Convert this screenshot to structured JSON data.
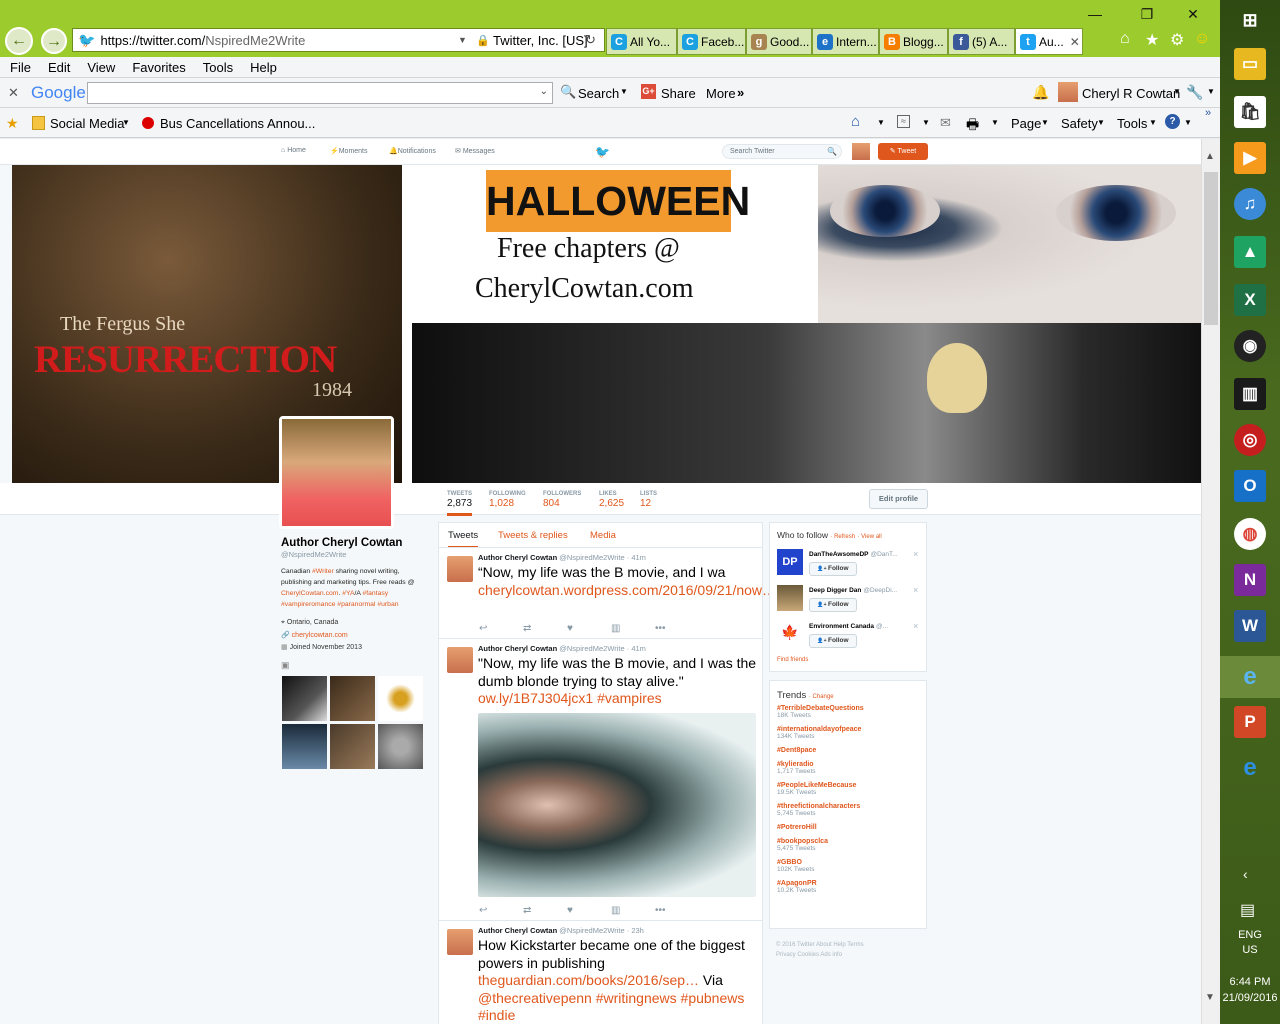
{
  "browser": {
    "url_prefix": "https://twitter.com/",
    "url_path": "NspiredMe2Write",
    "cert": "Twitter, Inc. [US]",
    "tabs": [
      {
        "label": "All Yo...",
        "icon": "C",
        "color": "#1ba0e0"
      },
      {
        "label": "Faceb...",
        "icon": "C",
        "color": "#1ba0e0"
      },
      {
        "label": "Good...",
        "icon": "g",
        "color": "#a88450"
      },
      {
        "label": "Intern...",
        "icon": "e",
        "color": "#1e73c8"
      },
      {
        "label": "Blogg...",
        "icon": "B",
        "color": "#f57d00"
      },
      {
        "label": "(5) A...",
        "icon": "f",
        "color": "#3b5998"
      },
      {
        "label": "Au...",
        "icon": "t",
        "color": "#1da1f2"
      }
    ],
    "menu": [
      "File",
      "Edit",
      "View",
      "Favorites",
      "Tools",
      "Help"
    ],
    "google_logo": "Google",
    "search_label": "Search",
    "share_label": "Share",
    "more_label": "More",
    "user_name": "Cheryl R Cowtan",
    "favorites": [
      "Social Media",
      "Bus Cancellations Annou..."
    ],
    "cmd": [
      "Page",
      "Safety",
      "Tools"
    ]
  },
  "twitter_nav": {
    "home": "Home",
    "moments": "Moments",
    "notifications": "Notifications",
    "messages": "Messages",
    "search_placeholder": "Search Twitter",
    "tweet_button": "Tweet"
  },
  "banner": {
    "book_line1": "The Fergus She",
    "book_line2": "RESURRECTION",
    "book_year": "1984",
    "halloween": "HALLOWEEN",
    "free_chapters": "Free chapters @",
    "site": "CherylCowtan.com"
  },
  "stats": [
    {
      "label": "TWEETS",
      "value": "2,873"
    },
    {
      "label": "FOLLOWING",
      "value": "1,028"
    },
    {
      "label": "FOLLOWERS",
      "value": "804"
    },
    {
      "label": "LIKES",
      "value": "2,625"
    },
    {
      "label": "LISTS",
      "value": "12"
    }
  ],
  "edit_profile": "Edit profile",
  "profile": {
    "name": "Author Cheryl Cowtan",
    "handle": "@NspiredMe2Write",
    "bio1": "Canadian ",
    "bio_writer": "#Writer",
    "bio2": " sharing novel writing, publishing and marketing tips. Free reads @ ",
    "bio_site": "CherylCowtan.com",
    "bio3": ". ",
    "bio_tags1": "#YA",
    "bio_slash": "/A ",
    "bio_tags2": "#fantasy #vampireromance #paranormal #urban",
    "location": "Ontario, Canada",
    "website": "cherylcowtan.com",
    "joined": "Joined November 2013"
  },
  "timeline_tabs": [
    "Tweets",
    "Tweets & replies",
    "Media"
  ],
  "tweets": [
    {
      "author": "Author Cheryl Cowtan",
      "meta": "@NspiredMe2Write · 41m",
      "text": "“Now, my life was the B movie, and I wa",
      "link": "cherylcowtan.wordpress.com/2016/09/21/now…"
    },
    {
      "author": "Author Cheryl Cowtan",
      "meta": "@NspiredMe2Write · 41m",
      "text": "\"Now, my life was the B movie, and I was the dumb blonde trying to stay alive.\"",
      "link": "ow.ly/1B7J304jcx1 #vampires"
    },
    {
      "author": "Author Cheryl Cowtan",
      "meta": "@NspiredMe2Write · 23h",
      "text": "How Kickstarter became one of the biggest powers in publishing",
      "link": "theguardian.com/books/2016/sep…",
      "via": " Via",
      "link2": "@thecreativepenn #writingnews #pubnews #indie"
    }
  ],
  "who_to_follow": {
    "title": "Who to follow",
    "refresh": "· Refresh",
    "view_all": "· View all",
    "follow_label": "Follow",
    "find_friends": "Find friends",
    "people": [
      {
        "name": "DanTheAwsomeDP",
        "handle": "@DanT..."
      },
      {
        "name": "Deep Digger Dan",
        "handle": "@DeepDi..."
      },
      {
        "name": "Environment Canada",
        "handle": "@..."
      }
    ]
  },
  "trends": {
    "title": "Trends",
    "change": "· Change",
    "items": [
      {
        "tag": "#TerribleDebateQuestions",
        "count": "18K Tweets"
      },
      {
        "tag": "#internationaldayofpeace",
        "count": "134K Tweets"
      },
      {
        "tag": "#Dent8pace",
        "count": ""
      },
      {
        "tag": "#kylieradio",
        "count": "1,717 Tweets"
      },
      {
        "tag": "#PeopleLikeMeBecause",
        "count": "19.5K Tweets"
      },
      {
        "tag": "#threefictionalcharacters",
        "count": "5,745 Tweets"
      },
      {
        "tag": "#PotreroHill",
        "count": ""
      },
      {
        "tag": "#bookpopsclca",
        "count": "5,475 Tweets"
      },
      {
        "tag": "#GBBO",
        "count": "102K Tweets"
      },
      {
        "tag": "#ApagonPR",
        "count": "10.2K Tweets"
      }
    ]
  },
  "footer": {
    "line1": "© 2016 Twitter   About   Help   Terms",
    "line2": "Privacy   Cookies   Ads info"
  },
  "taskbar": {
    "lang1": "ENG",
    "lang2": "US",
    "time": "6:44 PM",
    "date": "21/09/2016"
  },
  "colors": {
    "accent": "#e0571d",
    "ie_chrome": "#9ccb2d",
    "taskbar": "#3c5a18"
  }
}
